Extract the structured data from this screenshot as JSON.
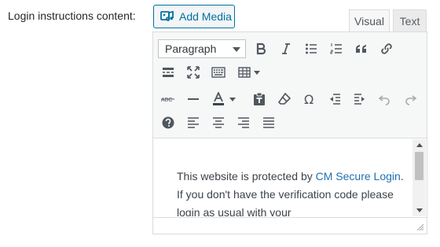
{
  "field": {
    "label": "Login instructions content:"
  },
  "add_media": {
    "label": "Add Media",
    "icon": "media-icon"
  },
  "tabs": [
    {
      "label": "Visual",
      "active": true
    },
    {
      "label": "Text",
      "active": false
    }
  ],
  "toolbar": {
    "format_select": {
      "value": "Paragraph"
    },
    "row1": [
      "bold-icon",
      "italic-icon",
      "bullet-list-icon",
      "numbered-list-icon",
      "blockquote-icon",
      "link-icon"
    ],
    "row2": [
      "read-more-icon",
      "fullscreen-icon",
      "toolbar-toggle-icon",
      "table-icon"
    ],
    "row3": [
      "strikethrough-icon",
      "horizontal-line-icon",
      "text-color-icon",
      "paste-text-icon",
      "clear-formatting-icon",
      "special-character-icon",
      "outdent-icon",
      "indent-icon",
      "undo-icon",
      "redo-icon"
    ],
    "row4": [
      "help-icon",
      "align-left-icon",
      "align-center-icon",
      "align-right-icon",
      "justify-icon"
    ]
  },
  "content": {
    "text_before": "This website is protected by ",
    "link_text": "CM Secure Login",
    "text_after": ". If you don't have the verification code please login as usual with your"
  },
  "colors": {
    "accent": "#0071a1",
    "link": "#2271b1",
    "toolbar_bg": "#f6f7f7",
    "border": "#dcdcde"
  }
}
